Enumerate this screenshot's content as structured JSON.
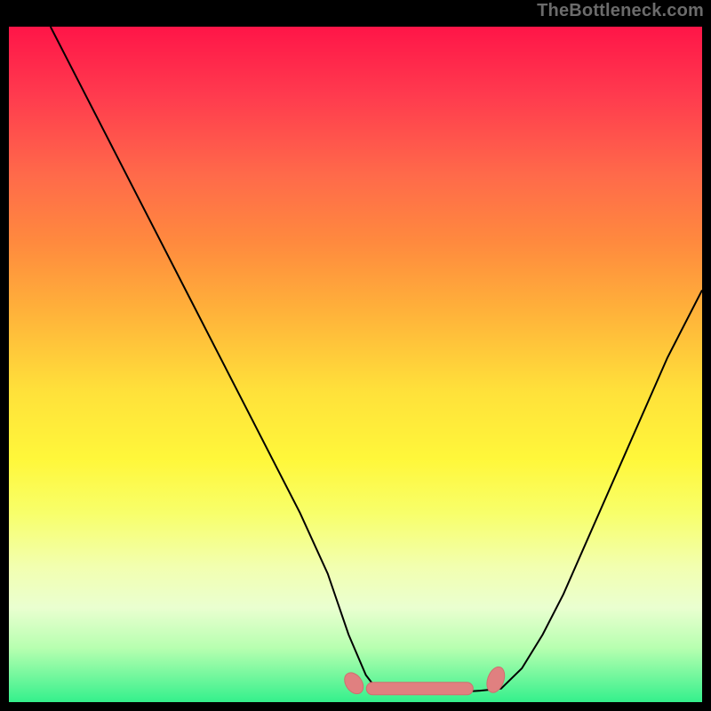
{
  "watermark": "TheBottleneck.com",
  "colors": {
    "curve": "#000000",
    "floor_marker": "#e08080",
    "floor_marker_stroke": "#cf6f6f"
  },
  "chart_data": {
    "type": "line",
    "title": "",
    "xlabel": "",
    "ylabel": "",
    "xlim": [
      0,
      100
    ],
    "ylim": [
      0,
      100
    ],
    "grid": false,
    "axes_visible": false,
    "series": [
      {
        "name": "left-branch",
        "x": [
          6,
          10,
          14,
          18,
          22,
          26,
          30,
          34,
          38,
          42,
          46,
          49,
          51.5,
          53
        ],
        "y": [
          100,
          92,
          84,
          76,
          68,
          60,
          52,
          44,
          36,
          28,
          19,
          10,
          4,
          2
        ]
      },
      {
        "name": "floor",
        "x": [
          53,
          56,
          59,
          62,
          65,
          68,
          71
        ],
        "y": [
          2,
          1.5,
          1.3,
          1.3,
          1.5,
          1.7,
          2
        ]
      },
      {
        "name": "right-branch",
        "x": [
          71,
          74,
          77,
          80,
          83,
          86,
          89,
          92,
          95,
          98,
          100
        ],
        "y": [
          2,
          5,
          10,
          16,
          23,
          30,
          37,
          44,
          51,
          57,
          61
        ]
      }
    ],
    "annotations": [
      {
        "name": "floor-highlight",
        "type": "marker",
        "shape": "capsule",
        "x_range": [
          49,
          71
        ],
        "y": 2,
        "note": "salmon segmented marker along valley floor"
      }
    ]
  }
}
